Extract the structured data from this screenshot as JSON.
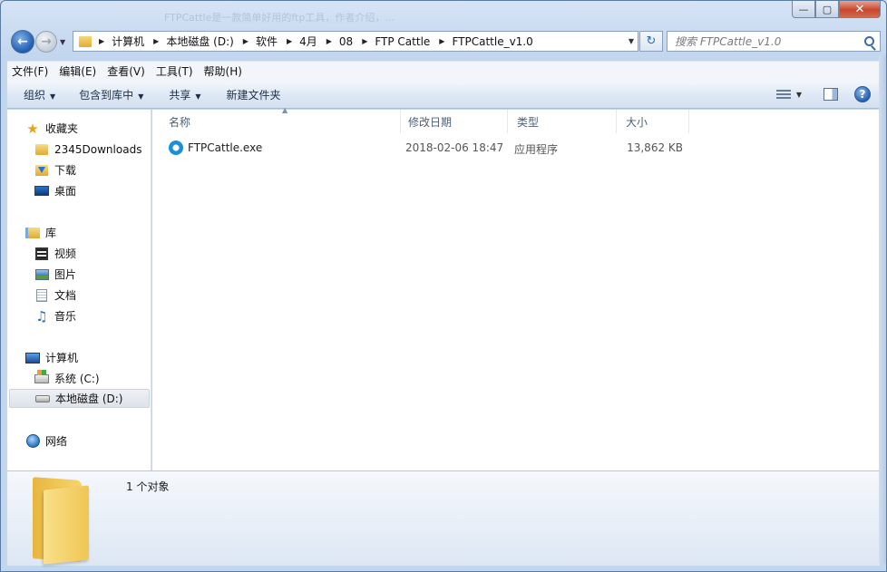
{
  "window": {
    "title_blur": "FTPCattle是一款简单好用的ftp工具，作者介绍，...",
    "min_label": "—",
    "max_label": "▢",
    "close_label": "✕"
  },
  "address": {
    "crumbs": [
      "计算机",
      "本地磁盘 (D:)",
      "软件",
      "4月",
      "08",
      "FTP Cattle",
      "FTPCattle_v1.0"
    ]
  },
  "search": {
    "placeholder": "搜索 FTPCattle_v1.0"
  },
  "menu": [
    "文件(F)",
    "编辑(E)",
    "查看(V)",
    "工具(T)",
    "帮助(H)"
  ],
  "toolbar": {
    "organize": "组织",
    "include_library": "包含到库中",
    "share": "共享",
    "new_folder": "新建文件夹",
    "help": "?"
  },
  "nav": {
    "favorites": "收藏夹",
    "downloads2345": "2345Downloads",
    "downloads": "下载",
    "desktop": "桌面",
    "libraries": "库",
    "videos": "视频",
    "pictures": "图片",
    "documents": "文档",
    "music": "音乐",
    "computer": "计算机",
    "drive_c": "系统 (C:)",
    "drive_d": "本地磁盘 (D:)",
    "network": "网络"
  },
  "columns": {
    "name": "名称",
    "date": "修改日期",
    "type": "类型",
    "size": "大小"
  },
  "files": [
    {
      "name": "FTPCattle.exe",
      "date": "2018-02-06 18:47",
      "type": "应用程序",
      "size": "13,862 KB"
    }
  ],
  "details": {
    "count": "1 个对象"
  },
  "icons": {
    "back": "arrow-left-icon",
    "forward": "arrow-right-icon",
    "refresh": "refresh-icon",
    "search": "search-icon",
    "help": "help-icon"
  }
}
